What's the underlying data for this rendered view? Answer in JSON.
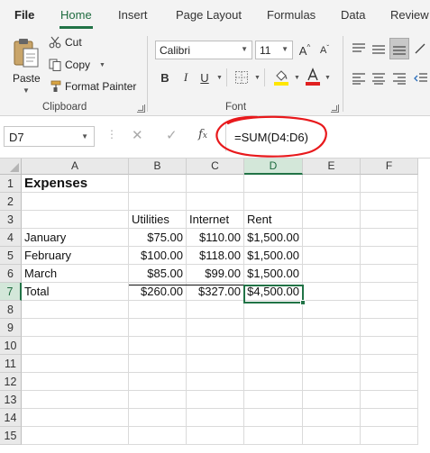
{
  "ribbon_tabs": [
    "File",
    "Home",
    "Insert",
    "Page Layout",
    "Formulas",
    "Data",
    "Review"
  ],
  "active_tab": "Home",
  "clipboard": {
    "paste_label": "Paste",
    "cut_label": "Cut",
    "copy_label": "Copy",
    "format_painter_label": "Format Painter",
    "group_label": "Clipboard"
  },
  "font": {
    "font_name": "Calibri",
    "font_size": "11",
    "bold": "B",
    "italic": "I",
    "underline": "U",
    "increase": "A",
    "decrease": "A",
    "group_label": "Font",
    "font_color": "#e02020",
    "fill_color": "#ffe600"
  },
  "formula_bar": {
    "name_box": "D7",
    "fx_label": "fx",
    "formula": "=SUM(D4:D6)",
    "annotation_color": "#e8191c"
  },
  "accent_color": "#217346",
  "grid": {
    "columns": [
      "A",
      "B",
      "C",
      "D",
      "E",
      "F"
    ],
    "selected_column": "D",
    "rows": [
      "1",
      "2",
      "3",
      "4",
      "5",
      "6",
      "7",
      "8",
      "9",
      "10",
      "11",
      "12",
      "13",
      "14",
      "15"
    ],
    "selected_row": "7",
    "selected_cell": "D7",
    "cells": {
      "A1": "Expenses",
      "B3": "Utilities",
      "C3": "Internet",
      "D3": "Rent",
      "A4": "January",
      "B4": "$75.00",
      "C4": "$110.00",
      "D4": "$1,500.00",
      "A5": "February",
      "B5": "$100.00",
      "C5": "$118.00",
      "D5": "$1,500.00",
      "A6": "March",
      "B6": "$85.00",
      "C6": "$99.00",
      "D6": "$1,500.00",
      "A7": "Total",
      "B7": "$260.00",
      "C7": "$327.00",
      "D7": "$4,500.00"
    }
  }
}
